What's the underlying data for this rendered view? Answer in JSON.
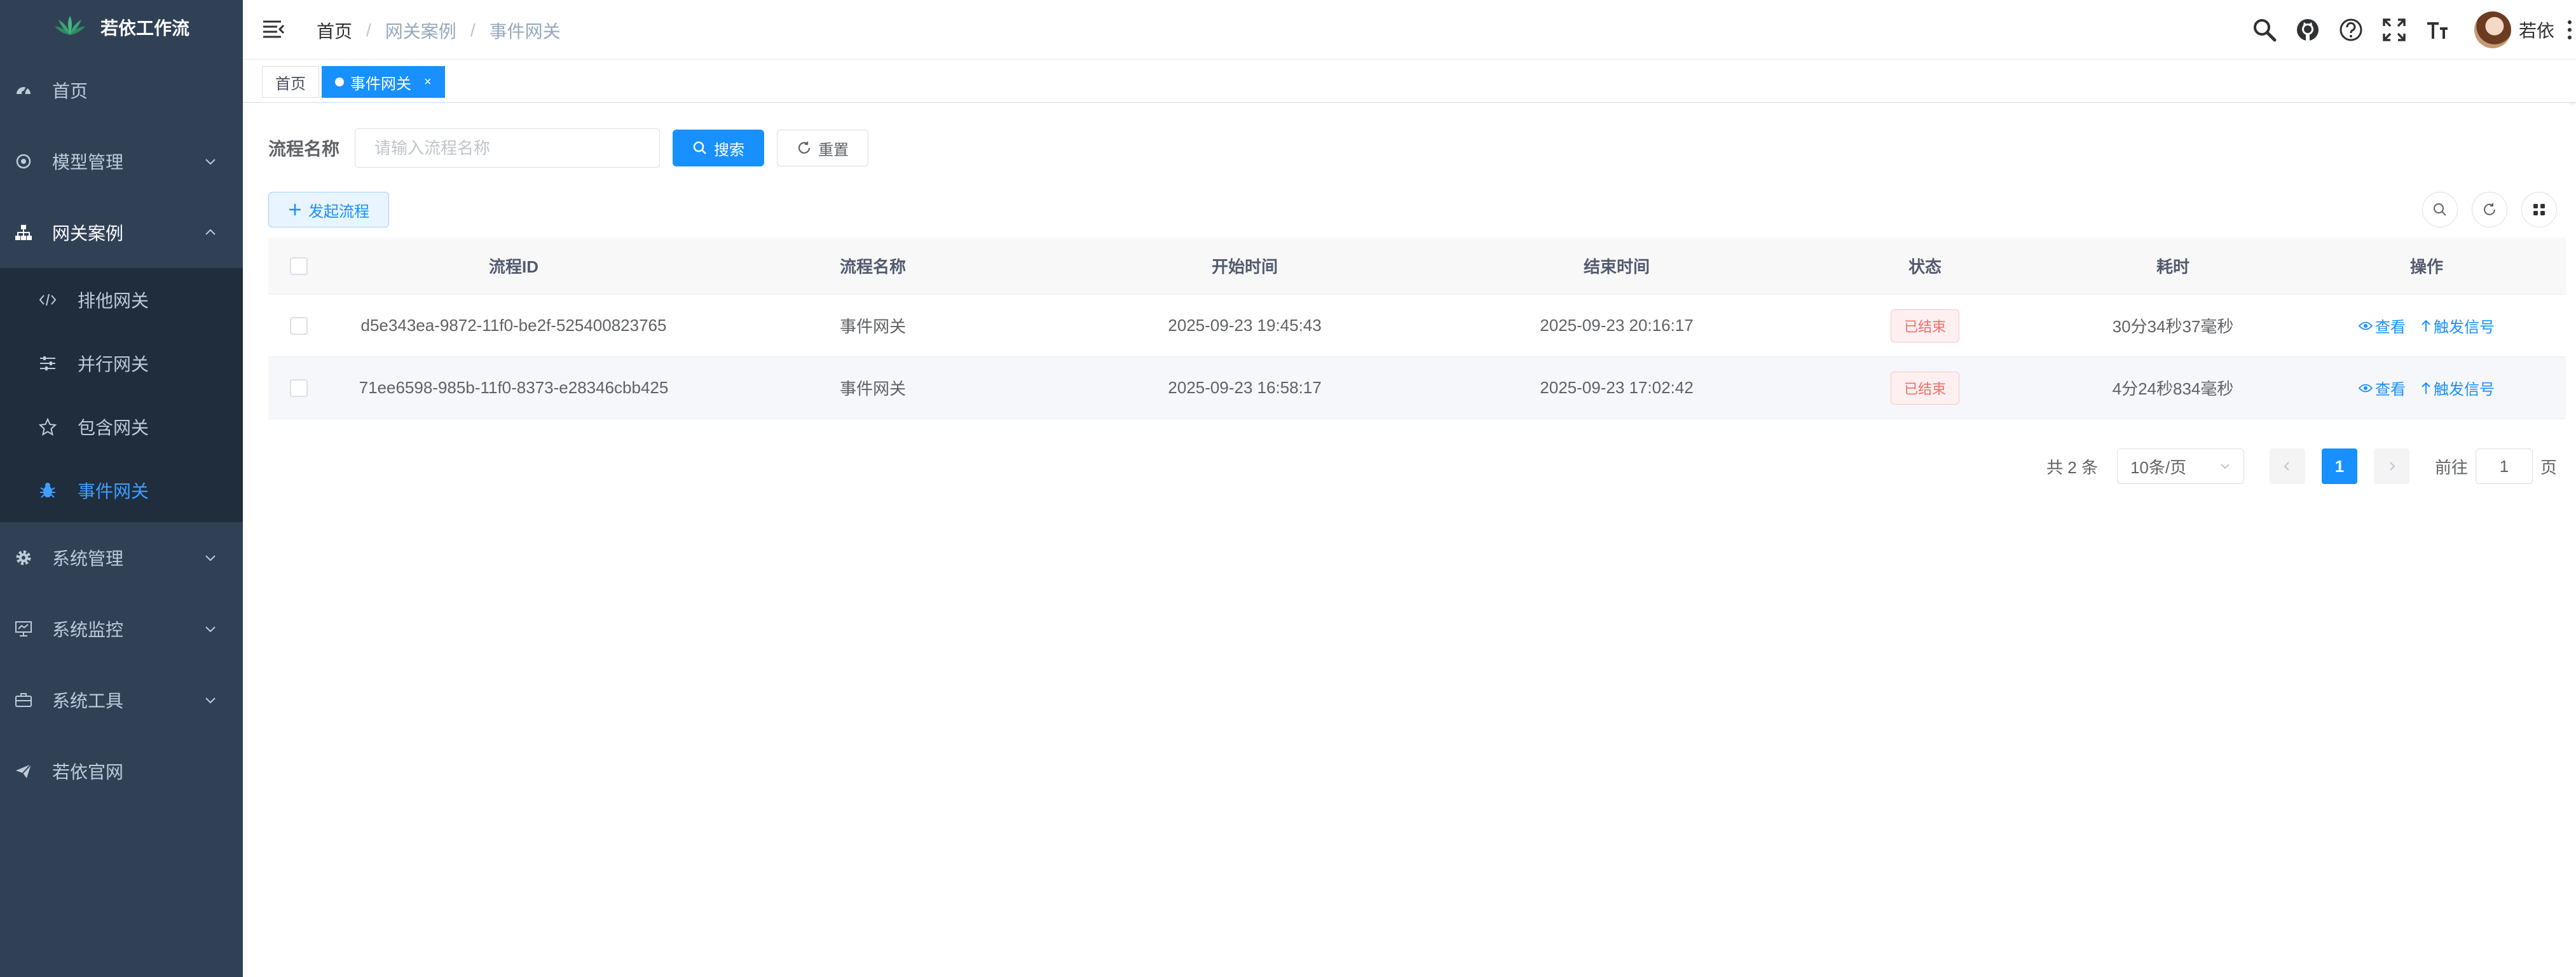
{
  "app": {
    "title": "若依工作流"
  },
  "sidebar": {
    "items": [
      {
        "label": "首页",
        "icon": "dashboard-icon"
      },
      {
        "label": "模型管理",
        "icon": "model-icon"
      },
      {
        "label": "网关案例",
        "icon": "tree-icon",
        "expanded": true,
        "children": [
          {
            "label": "排他网关",
            "icon": "code-icon"
          },
          {
            "label": "并行网关",
            "icon": "sliders-icon"
          },
          {
            "label": "包含网关",
            "icon": "star-icon"
          },
          {
            "label": "事件网关",
            "icon": "bug-icon",
            "active": true
          }
        ]
      },
      {
        "label": "系统管理",
        "icon": "gear-icon"
      },
      {
        "label": "系统监控",
        "icon": "monitor-icon"
      },
      {
        "label": "系统工具",
        "icon": "toolbox-icon"
      },
      {
        "label": "若依官网",
        "icon": "send-icon"
      }
    ]
  },
  "header": {
    "breadcrumb": [
      "首页",
      "网关案例",
      "事件网关"
    ],
    "breadcrumb_separator": "/",
    "user_name": "若依",
    "icons": [
      "search-icon",
      "github-icon",
      "help-icon",
      "fullscreen-icon",
      "font-size-icon"
    ]
  },
  "tags": [
    {
      "label": "首页",
      "active": false
    },
    {
      "label": "事件网关",
      "active": true,
      "close": "×"
    }
  ],
  "search": {
    "label": "流程名称",
    "placeholder": "请输入流程名称",
    "value": "",
    "search_button": "搜索",
    "reset_button": "重置"
  },
  "toolbar": {
    "start_button": "发起流程"
  },
  "table": {
    "columns": [
      "流程ID",
      "流程名称",
      "开始时间",
      "结束时间",
      "状态",
      "耗时",
      "操作"
    ],
    "rows": [
      {
        "id": "d5e343ea-9872-11f0-be2f-525400823765",
        "name": "事件网关",
        "start": "2025-09-23 19:45:43",
        "end": "2025-09-23 20:16:17",
        "status": "已结束",
        "duration": "30分34秒37毫秒",
        "view": "查看",
        "signal": "触发信号"
      },
      {
        "id": "71ee6598-985b-11f0-8373-e28346cbb425",
        "name": "事件网关",
        "start": "2025-09-23 16:58:17",
        "end": "2025-09-23 17:02:42",
        "status": "已结束",
        "duration": "4分24秒834毫秒",
        "view": "查看",
        "signal": "触发信号"
      }
    ]
  },
  "pagination": {
    "total_text": "共 2 条",
    "page_size": "10条/页",
    "current_page": "1",
    "goto_prefix": "前往",
    "goto_value": "1",
    "goto_suffix": "页"
  },
  "colors": {
    "sidebar_bg": "#304156",
    "primary": "#1890ff",
    "danger": "#f56c6c"
  }
}
